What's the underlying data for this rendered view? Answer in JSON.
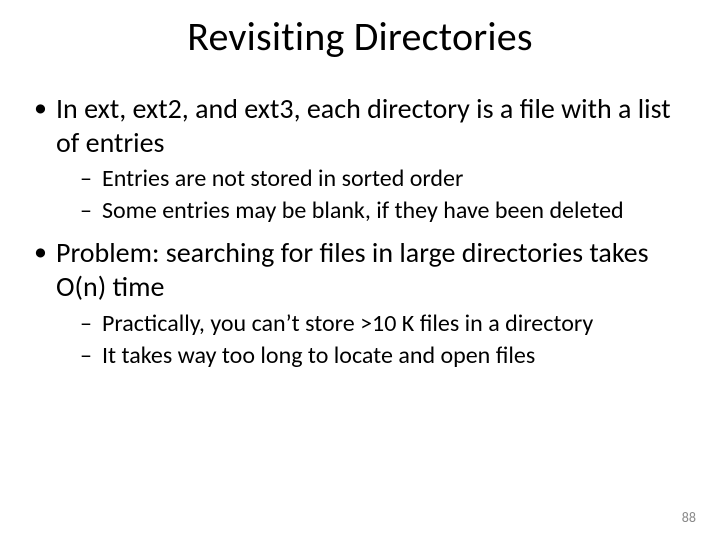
{
  "title": "Revisiting Directories",
  "bullets": {
    "b1": "In ext, ext2, and ext3, each directory is a file with a list of entries",
    "s1a": "Entries are not stored in sorted order",
    "s1b": "Some entries may be blank, if they have been deleted",
    "b2": "Problem: searching for files in large directories takes O(n) time",
    "s2a": "Practically, you can’t store >10 K files in a directory",
    "s2b": "It takes way too long to locate and open files"
  },
  "page_number": "88"
}
